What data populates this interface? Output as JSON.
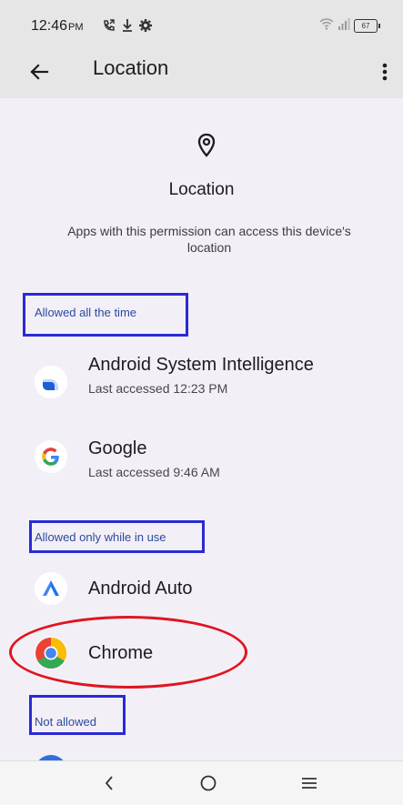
{
  "status_bar": {
    "time": "12:46",
    "ampm": "PM",
    "battery": "67"
  },
  "app_bar": {
    "title": "Location"
  },
  "header": {
    "title": "Location",
    "description": "Apps with this permission can access this device's location"
  },
  "sections": {
    "allowed_all_time": {
      "label": "Allowed all the time",
      "apps": [
        {
          "name": "Android System Intelligence",
          "subtitle": "Last accessed 12:23 PM"
        },
        {
          "name": "Google",
          "subtitle": "Last accessed 9:46 AM"
        }
      ]
    },
    "allowed_while_in_use": {
      "label": "Allowed only while in use",
      "apps": [
        {
          "name": "Android Auto"
        },
        {
          "name": "Chrome"
        }
      ]
    },
    "not_allowed": {
      "label": "Not allowed"
    }
  },
  "colors": {
    "background": "#f3eff7",
    "app_bar": "#e6e6e6",
    "section_header_text": "#2b4a9b",
    "annotation_box": "#2a2ad6",
    "annotation_ellipse": "#e0141e"
  },
  "icons": {
    "back": "arrow-left-icon",
    "more": "more-vertical-icon",
    "location": "location-pin-icon",
    "nav_back": "chevron-left-icon",
    "nav_home": "circle-home-icon",
    "nav_recents": "menu-lines-icon"
  }
}
